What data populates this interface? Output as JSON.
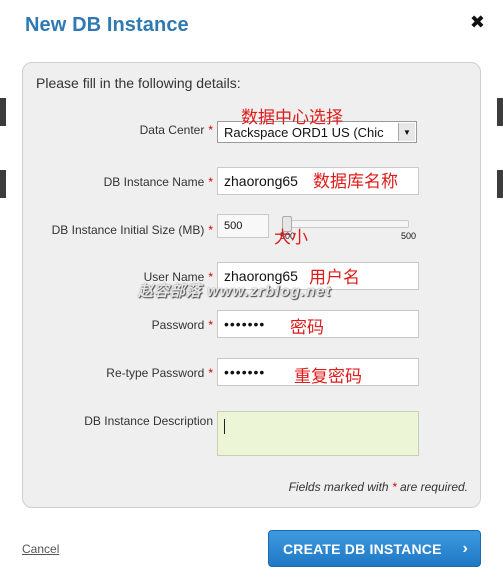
{
  "dialog": {
    "title": "New DB Instance",
    "close_glyph": "✖",
    "intro": "Please fill in the following details:"
  },
  "form": {
    "data_center": {
      "label": "Data Center",
      "value": "Rackspace ORD1 US (Chic"
    },
    "instance_name": {
      "label": "DB Instance Name",
      "value": "zhaorong65"
    },
    "initial_size": {
      "label": "DB Instance Initial Size (MB)",
      "value": "500",
      "slider_min_label": "500",
      "slider_max_label": "500"
    },
    "user_name": {
      "label": "User Name",
      "value": "zhaorong65"
    },
    "password": {
      "label": "Password",
      "value": "•••••••"
    },
    "retype_password": {
      "label": "Re-type Password",
      "value": "•••••••"
    },
    "description": {
      "label": "DB Instance Description",
      "value": ""
    },
    "required_marker": "*",
    "note_prefix": "Fields marked with ",
    "note_suffix": " are required."
  },
  "annotations": {
    "data_center": "数据中心选择",
    "instance_name": "数据库名称",
    "size": "大小",
    "user_name": "用户名",
    "password": "密码",
    "retype_password": "重复密码"
  },
  "watermark": "赵容部落 www.zrblog.net",
  "actions": {
    "cancel": "Cancel",
    "create": "CREATE DB INSTANCE",
    "create_chevron": "›"
  },
  "colors": {
    "title": "#2f79b3",
    "annotation": "#e01b1b",
    "primary_button": "#2a88d2",
    "description_bg": "#ecf5d6"
  }
}
